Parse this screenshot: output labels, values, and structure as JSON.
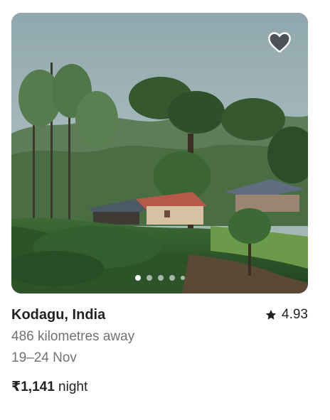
{
  "listing": {
    "title": "Kodagu, India",
    "rating": "4.93",
    "distance": "486 kilometres away",
    "dates": "19–24 Nov",
    "price": "₹1,141",
    "price_unit": " night"
  },
  "photo": {
    "alt": "Hillside cottages among coffee plantation and tall trees",
    "total_images": 5,
    "active_index": 0
  },
  "icons": {
    "wishlist": "heart-icon",
    "rating": "star-icon"
  },
  "colors": {
    "text_primary": "#222222",
    "text_secondary": "#717171",
    "heart_fill": "#3f4248"
  }
}
